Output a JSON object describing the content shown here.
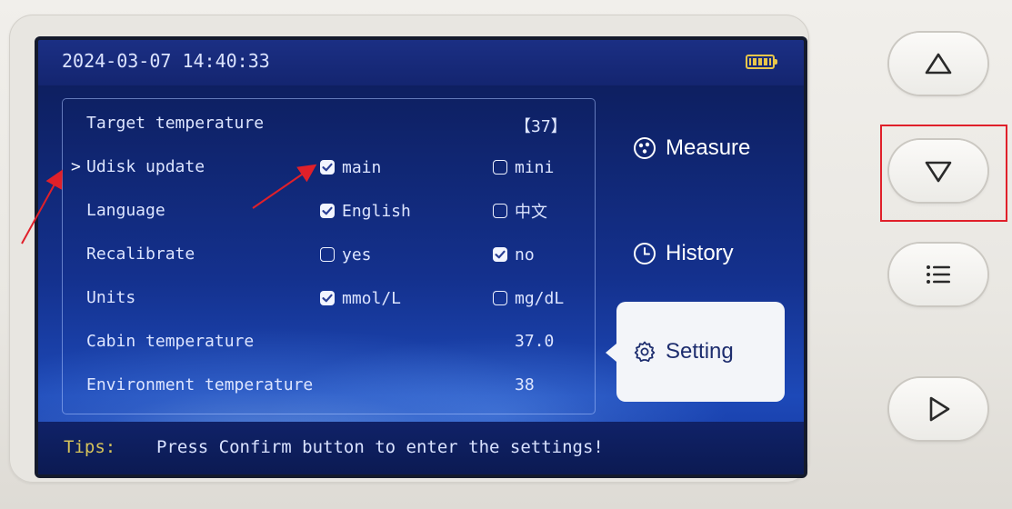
{
  "screen": {
    "datetime": "2024-03-07 14:40:33",
    "battery_icon": "battery-full-icon"
  },
  "settings": {
    "rows": [
      {
        "label": "Target temperature",
        "value": "【37】"
      },
      {
        "label": "Udisk update",
        "pointer": ">",
        "options": [
          {
            "label": "main",
            "checked": true
          },
          {
            "label": "mini",
            "checked": false
          }
        ]
      },
      {
        "label": "Language",
        "options": [
          {
            "label": "English",
            "checked": true
          },
          {
            "label": "中文",
            "checked": false
          }
        ]
      },
      {
        "label": "Recalibrate",
        "options": [
          {
            "label": "yes",
            "checked": false
          },
          {
            "label": "no",
            "checked": true
          }
        ]
      },
      {
        "label": "Units",
        "options": [
          {
            "label": "mmol/L",
            "checked": true
          },
          {
            "label": "mg/dL",
            "checked": false
          }
        ]
      },
      {
        "label": "Cabin temperature",
        "value": "37.0"
      },
      {
        "label": "Environment temperature",
        "value": "38"
      }
    ]
  },
  "menu": {
    "items": [
      {
        "label": "Measure",
        "icon": "measure-icon",
        "active": false
      },
      {
        "label": "History",
        "icon": "clock-icon",
        "active": false
      },
      {
        "label": "Setting",
        "icon": "gear-icon",
        "active": true
      }
    ]
  },
  "tips": {
    "label": "Tips:",
    "text": "Press Confirm button to enter the settings!"
  },
  "hardware_buttons": [
    {
      "icon": "triangle-up-icon"
    },
    {
      "icon": "triangle-down-icon",
      "highlighted": true
    },
    {
      "icon": "menu-list-icon"
    },
    {
      "icon": "triangle-right-icon"
    }
  ],
  "colors": {
    "screen_bg": "#0b1a52",
    "accent_white": "#f3f5f9",
    "tips_label": "#d6c35a",
    "annotation_red": "#e0202a"
  }
}
